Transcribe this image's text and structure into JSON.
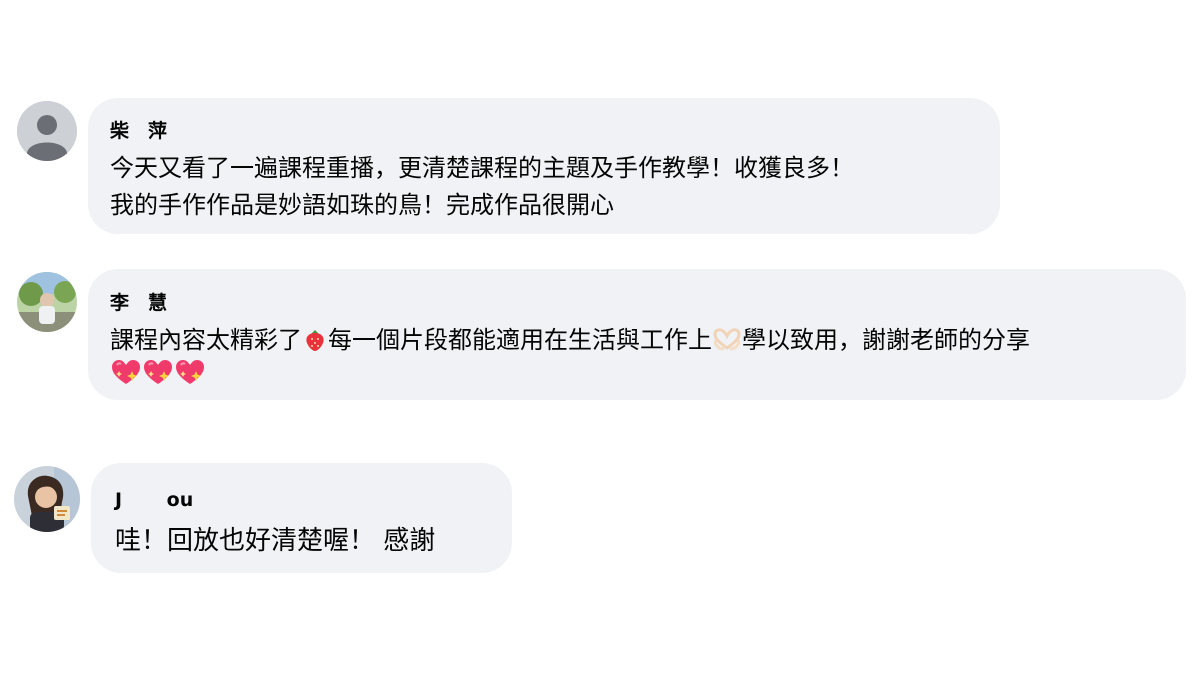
{
  "comments": [
    {
      "author": "柴　萍",
      "avatar": "default-avatar",
      "lines": [
        "今天又看了一遍課程重播，更清楚課程的主題及手作教學！收獲良多！",
        "我的手作作品是妙語如珠的鳥！完成作品很開心"
      ]
    },
    {
      "author": "李　慧",
      "avatar": "photo-avatar",
      "line1_a": "課程內容太精彩了",
      "line1_emoji1": "strawberry-icon",
      "line1_b": "每一個片段都能適用在生活與工作上",
      "line1_emoji2": "heart-hands-icon",
      "line1_c": "學以致用，謝謝老師的分享",
      "line2_emojis": [
        "sparkling-heart-icon",
        "sparkling-heart-icon",
        "sparkling-heart-icon"
      ]
    },
    {
      "author": "J　　 ou",
      "avatar": "photo-avatar",
      "lines": [
        "哇！回放也好清楚喔！ 感謝"
      ]
    }
  ],
  "colors": {
    "bubble": "#f0f2f5",
    "text": "#050505",
    "default_avatar_bg": "#c8ccd1",
    "default_avatar_fg": "#ffffff"
  }
}
